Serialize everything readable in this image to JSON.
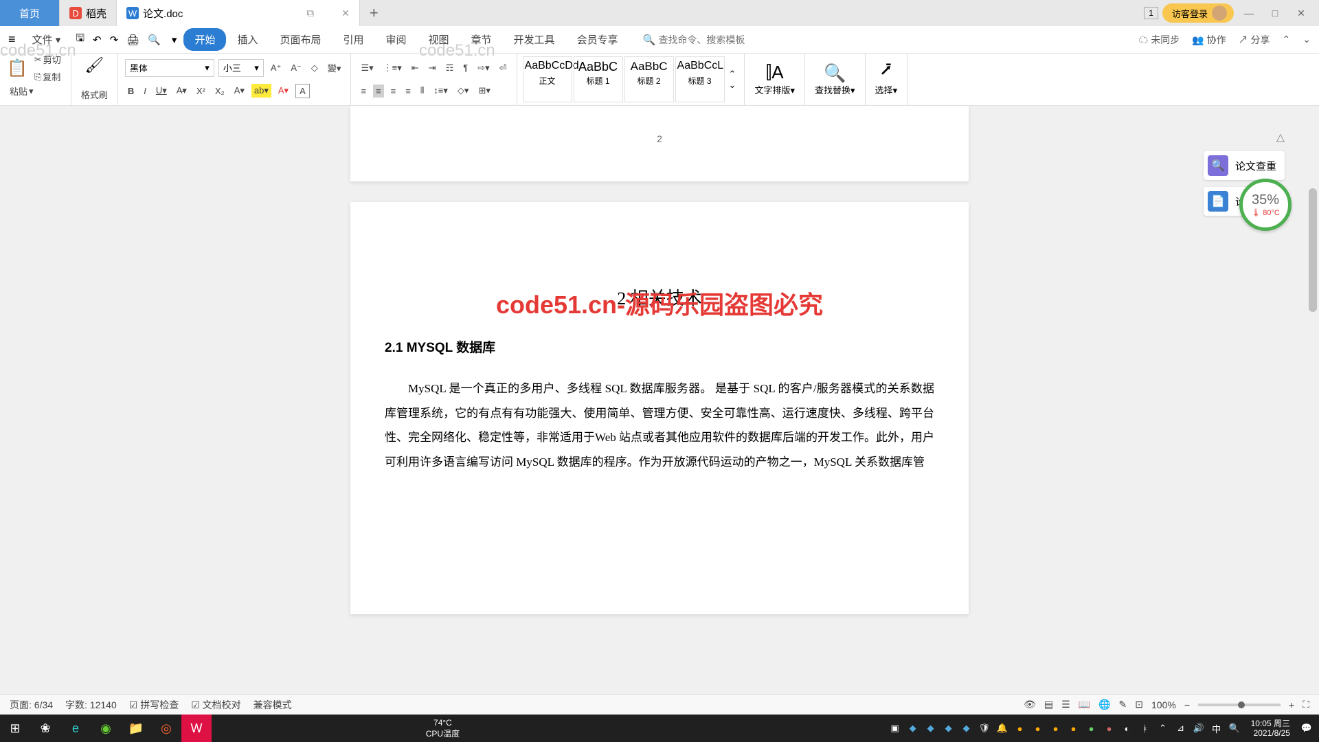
{
  "titlebar": {
    "home_tab": "首页",
    "tab1": "稻壳",
    "tab2": "论文.doc",
    "login": "访客登录",
    "badge": "1"
  },
  "menubar": {
    "file": "文件",
    "items": [
      "开始",
      "插入",
      "页面布局",
      "引用",
      "审阅",
      "视图",
      "章节",
      "开发工具",
      "会员专享"
    ],
    "search_placeholder": "查找命令、搜索模板",
    "unsync": "未同步",
    "collab": "协作",
    "share": "分享"
  },
  "ribbon": {
    "cut": "剪切",
    "copy": "复制",
    "paste": "粘贴",
    "format_painter": "格式刷",
    "font_name": "黑体",
    "font_size": "小三",
    "styles": [
      {
        "preview": "AaBbCcDd",
        "label": "正文"
      },
      {
        "preview": "AaBbC",
        "label": "标题 1"
      },
      {
        "preview": "AaBbC",
        "label": "标题 2"
      },
      {
        "preview": "AaBbCcL",
        "label": "标题 3"
      }
    ],
    "text_typeset": "文字排版",
    "find_replace": "查找替换",
    "select": "选择"
  },
  "document": {
    "page_number": "2",
    "heading1": "2 相关技术",
    "heading2": "2.1 MYSQL 数据库",
    "paragraph": "MySQL 是一个真正的多用户、多线程 SQL 数据库服务器。 是基于 SQL 的客户/服务器模式的关系数据库管理系统，它的有点有有功能强大、使用简单、管理方便、安全可靠性高、运行速度快、多线程、跨平台性、完全网络化、稳定性等，非常适用于Web 站点或者其他应用软件的数据库后端的开发工作。此外，用户可利用许多语言编写访问 MySQL 数据库的程序。作为开放源代码运动的产物之一，MySQL 关系数据库管"
  },
  "sidepanel": {
    "item1": "论文查重",
    "item2": "论文排版",
    "gauge_value": "35%",
    "gauge_temp": "80°C"
  },
  "statusbar": {
    "page": "页面: 6/34",
    "words": "字数: 12140",
    "spellcheck": "拼写检查",
    "proofread": "文档校对",
    "compat": "兼容模式",
    "zoom": "100%"
  },
  "taskbar": {
    "temp": "74°C",
    "cpu_temp": "CPU温度",
    "time": "10:05 周三",
    "date": "2021/8/25"
  },
  "watermark": {
    "text": "code51.cn",
    "big": "code51.cn-源码乐园盗图必究"
  }
}
